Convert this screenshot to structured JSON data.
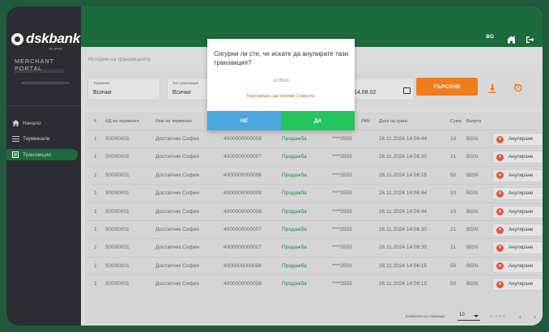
{
  "brand": {
    "name": "dskbank",
    "sub": "otp group",
    "portal": "MERCHANT PORTAL",
    "merchant_id": "5000000000000000"
  },
  "nav": [
    {
      "label": "Начало",
      "icon": "home-icon"
    },
    {
      "label": "Терминали",
      "icon": "list-icon"
    },
    {
      "label": "Транзакции",
      "icon": "receipt-icon"
    }
  ],
  "topbar": {
    "lang": "BG"
  },
  "breadcrumb": "История на транзакциите",
  "filters": {
    "terminal": {
      "label": "Терминал",
      "value": "Всички"
    },
    "type": {
      "label": "Тип транзакция",
      "value": "Всички"
    },
    "date_value": "14.08.02",
    "search_label": "ТЪРСЕНЕ"
  },
  "table": {
    "headers": [
      "#",
      "ИД на терминал",
      "Име на терминал",
      "",
      "",
      "PAN",
      "Дата на транс",
      "Сума",
      "Валута"
    ],
    "action_label": "Анулиране",
    "rows": [
      [
        "1",
        "S0000001",
        "Достапчик София",
        "4000000000008",
        "Продажба",
        "****3593",
        "26.11.2024 14:06:44",
        "10",
        "BGN"
      ],
      [
        "1",
        "S0000001",
        "Достапчик София",
        "4000000000007",
        "Продажба",
        "****3593",
        "26.11.2024 14:06:30",
        "21",
        "BGN"
      ],
      [
        "1",
        "S0000001",
        "Достапчик София",
        "4000000000006",
        "Продажба",
        "****3593",
        "26.11.2024 14:06:15",
        "50",
        "BGN"
      ],
      [
        "1",
        "S0000001",
        "Достапчик София",
        "4000000000008",
        "Продажба",
        "****3593",
        "26.11.2024 14:06:44",
        "10",
        "BGN"
      ],
      [
        "1",
        "S0000001",
        "Достапчик София",
        "4000000000008",
        "Продажба",
        "****3593",
        "26.11.2024 14:06:44",
        "10",
        "BGN"
      ],
      [
        "1",
        "S0000001",
        "Достапчик София",
        "4000000000007",
        "Продажба",
        "****3593",
        "26.11.2024 14:06:30",
        "21",
        "BGN"
      ],
      [
        "1",
        "S0000001",
        "Достапчик София",
        "4000000000007",
        "Продажба",
        "****3593",
        "26.11.2024 14:06:30",
        "21",
        "BGN"
      ],
      [
        "1",
        "S0000001",
        "Достапчик София",
        "4000000000006",
        "Продажба",
        "****3593",
        "26.11.2024 14:06:15",
        "50",
        "BGN"
      ],
      [
        "1",
        "S0000001",
        "Достапчик София",
        "4000000000006",
        "Продажба",
        "****3593",
        "26.11.2024 14:06:15",
        "50",
        "BGN"
      ]
    ]
  },
  "pager": {
    "label": "Елементи на страница:",
    "size": "10",
    "range": "1 - 2 от 3"
  },
  "dialog": {
    "message": "Сигурни ли сте, че искате да анулирате тази транзакция?",
    "amount": "10 BGN",
    "warning": "Този процес ще отнеме 1 минута.",
    "no_label": "НЕ",
    "yes_label": "ДА"
  }
}
